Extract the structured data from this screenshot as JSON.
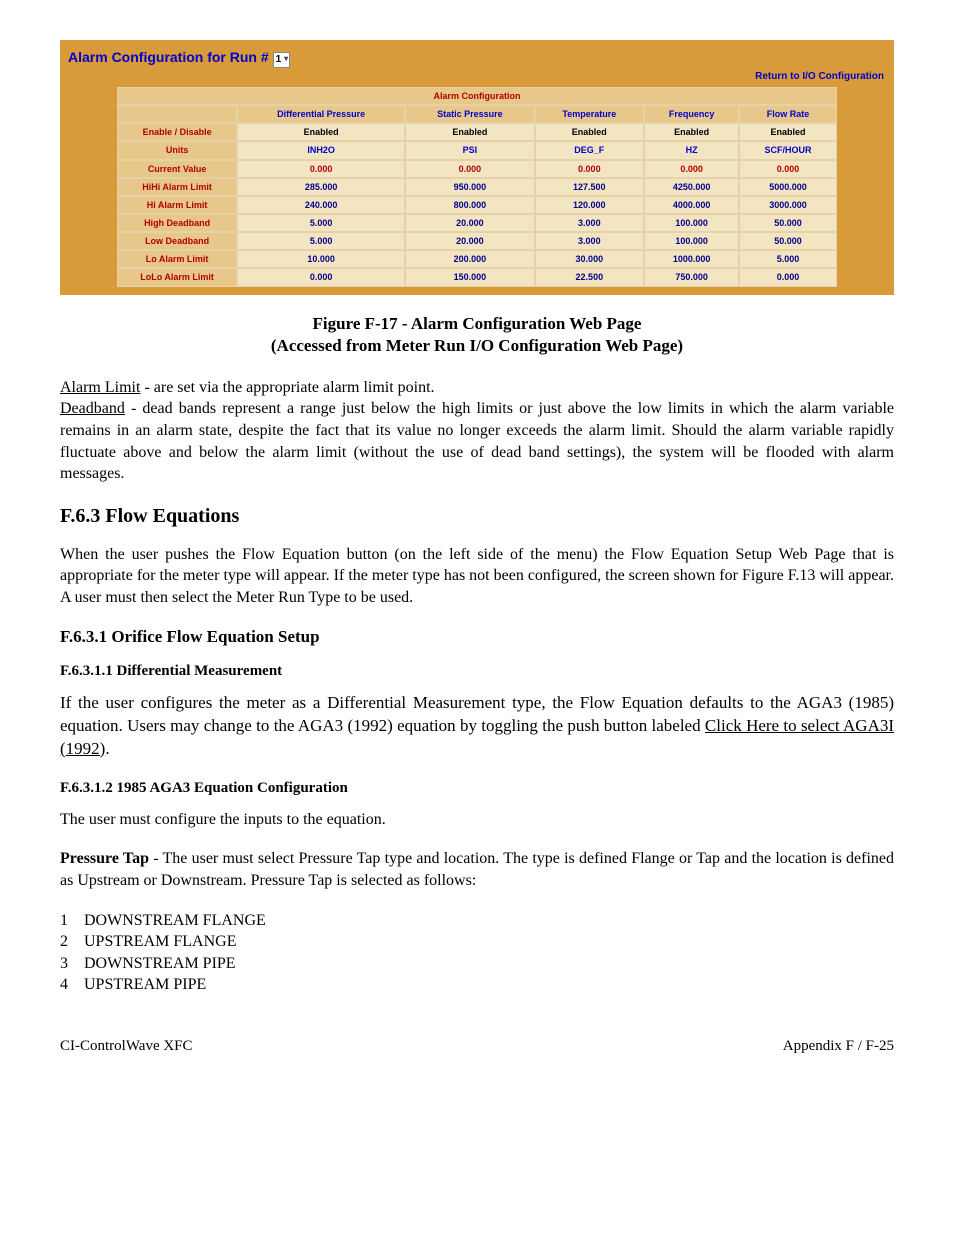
{
  "screenshot": {
    "header_prefix": "Alarm Configuration for Run # ",
    "run_value": "1",
    "return_link": "Return to I/O Configuration",
    "title": "Alarm Configuration",
    "col_headers": [
      "Differential Pressure",
      "Static Pressure",
      "Temperature",
      "Frequency",
      "Flow Rate"
    ],
    "rows": [
      {
        "label": "Enable / Disable",
        "cls": "ac-cell-enabled",
        "cells": [
          "Enabled",
          "Enabled",
          "Enabled",
          "Enabled",
          "Enabled"
        ]
      },
      {
        "label": "Units",
        "cls": "ac-cell-units",
        "cells": [
          "INH2O",
          "PSI",
          "DEG_F",
          "HZ",
          "SCF/HOUR"
        ]
      },
      {
        "label": "Current Value",
        "cls": "ac-cell-current",
        "cells": [
          "0.000",
          "0.000",
          "0.000",
          "0.000",
          "0.000"
        ]
      },
      {
        "label": "HiHi Alarm Limit",
        "cls": "ac-cell-num",
        "cells": [
          "285.000",
          "950.000",
          "127.500",
          "4250.000",
          "5000.000"
        ]
      },
      {
        "label": "Hi Alarm Limit",
        "cls": "ac-cell-num",
        "cells": [
          "240.000",
          "800.000",
          "120.000",
          "4000.000",
          "3000.000"
        ]
      },
      {
        "label": "High Deadband",
        "cls": "ac-cell-num",
        "cells": [
          "5.000",
          "20.000",
          "3.000",
          "100.000",
          "50.000"
        ]
      },
      {
        "label": "Low Deadband",
        "cls": "ac-cell-num",
        "cells": [
          "5.000",
          "20.000",
          "3.000",
          "100.000",
          "50.000"
        ]
      },
      {
        "label": "Lo Alarm Limit",
        "cls": "ac-cell-num",
        "cells": [
          "10.000",
          "200.000",
          "30.000",
          "1000.000",
          "5.000"
        ]
      },
      {
        "label": "LoLo Alarm Limit",
        "cls": "ac-cell-num",
        "cells": [
          "0.000",
          "150.000",
          "22.500",
          "750.000",
          "0.000"
        ]
      }
    ]
  },
  "caption": {
    "line1": "Figure F-17 - Alarm Configuration Web Page",
    "line2": "(Accessed from Meter Run I/O Configuration Web Page)"
  },
  "defs": {
    "alarm_limit_term": "Alarm Limit",
    "alarm_limit_text": " - are set via the appropriate alarm limit point.",
    "deadband_term": "Deadband",
    "deadband_text": " - dead bands represent a range just below the high limits or just above the low limits in which the alarm variable remains in an alarm state, despite the fact that its value no longer exceeds the alarm limit. Should the alarm variable rapidly fluctuate above and below the alarm limit (without the use of dead band settings), the system will be flooded with alarm messages."
  },
  "s63": {
    "heading": "F.6.3  Flow Equations",
    "para": "When the user pushes the Flow Equation button (on the left side of the menu) the Flow Equation Setup Web Page that is appropriate for the meter type will appear. If the meter type has not been configured, the screen shown for Figure F.13 will appear. A user must then select the Meter Run Type to be used."
  },
  "s631": {
    "heading": "F.6.3.1  Orifice Flow Equation Setup"
  },
  "s6311": {
    "heading": "F.6.3.1.1   Differential Measurement",
    "para_pre": "If the user configures the meter as a Differential Measurement type, the Flow Equation defaults to the AGA3 (1985) equation. Users may change to the AGA3 (1992) equation by toggling the push button labeled ",
    "link": "Click Here to select AGA3I (1992)",
    "para_post": "."
  },
  "s6312": {
    "heading": "F.6.3.1.2   1985 AGA3 Equation Configuration",
    "para1": "The user must configure the inputs to the equation.",
    "pt_label": "Pressure Tap",
    "pt_text": " - The user must select Pressure Tap type and location. The type is defined Flange or Tap and the location is defined as Upstream or Downstream. Pressure Tap is selected as follows:",
    "list": [
      {
        "n": "1",
        "t": "DOWNSTREAM FLANGE"
      },
      {
        "n": "2",
        "t": "UPSTREAM FLANGE"
      },
      {
        "n": "3",
        "t": "DOWNSTREAM PIPE"
      },
      {
        "n": "4",
        "t": "UPSTREAM PIPE"
      }
    ]
  },
  "footer": {
    "left": "CI-ControlWave XFC",
    "right": "Appendix F / F-25"
  }
}
